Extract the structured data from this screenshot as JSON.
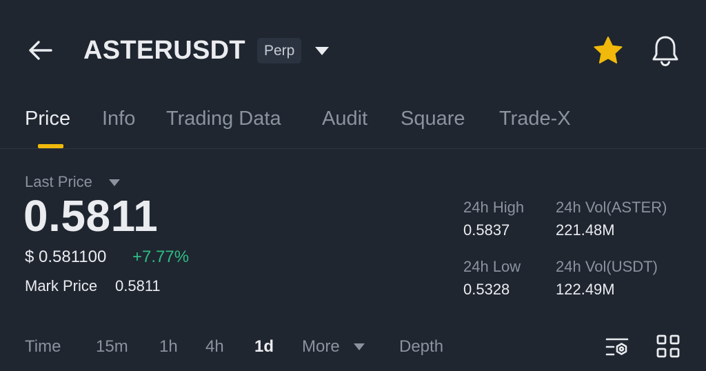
{
  "header": {
    "back_icon": "arrow-left-icon",
    "symbol": "ASTERUSDT",
    "contract_type": "Perp",
    "dropdown_icon": "caret-down-icon",
    "favorite_icon": "star-icon",
    "favorite_color": "#F0B90B",
    "alert_icon": "bell-icon"
  },
  "tabs": [
    {
      "label": "Price",
      "active": true
    },
    {
      "label": "Info"
    },
    {
      "label": "Trading Data"
    },
    {
      "label": "Audit"
    },
    {
      "label": "Square"
    },
    {
      "label": "Trade-X"
    }
  ],
  "price": {
    "label": "Last Price",
    "last": "0.5811",
    "usd": "$ 0.581100",
    "change": "+7.77%",
    "change_color": "#2EBD85",
    "mark_label": "Mark Price",
    "mark_value": "0.5811"
  },
  "stats": {
    "high_label": "24h High",
    "high_value": "0.5837",
    "low_label": "24h Low",
    "low_value": "0.5328",
    "vol_base_label": "24h Vol(ASTER)",
    "vol_base_value": "221.48M",
    "vol_quote_label": "24h Vol(USDT)",
    "vol_quote_value": "122.49M"
  },
  "timeframes": {
    "time": "Time",
    "items": [
      "15m",
      "1h",
      "4h",
      "1d"
    ],
    "selected": "1d",
    "more": "More",
    "depth": "Depth",
    "settings_icon": "chart-settings-icon",
    "layout_icon": "grid-icon"
  },
  "colors": {
    "background": "#1F2630",
    "accent": "#F0B90B",
    "up": "#2EBD85"
  }
}
